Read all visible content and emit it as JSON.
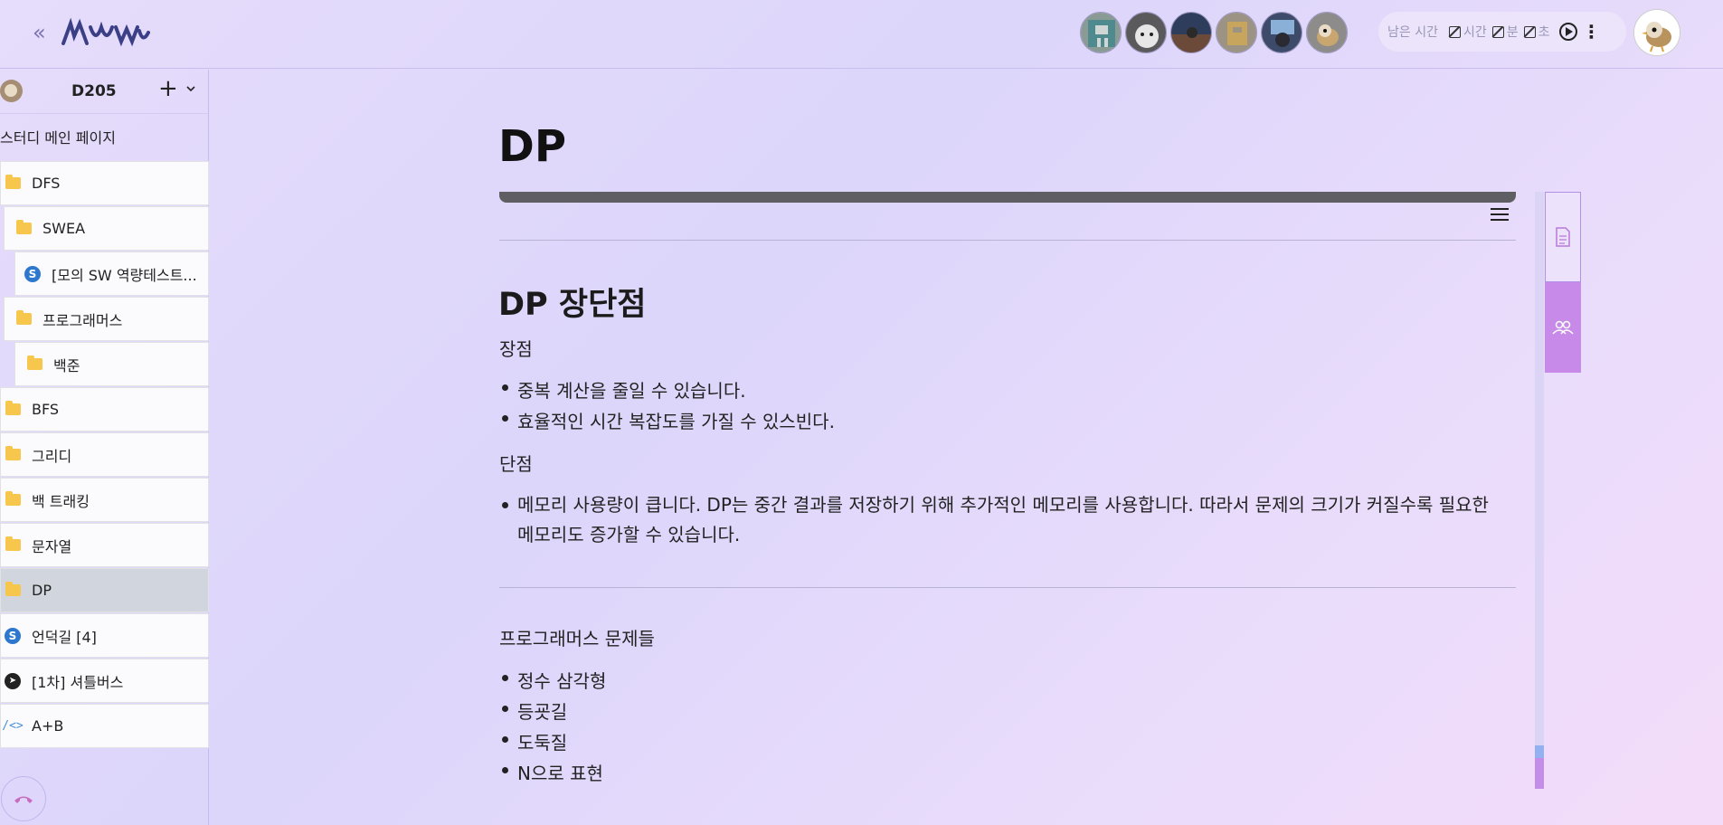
{
  "header": {
    "collapse_symbol": "«",
    "logo_text": "ɹʍʍ",
    "timer": {
      "label": "남은 시간",
      "hour": "시간",
      "minute": "분",
      "second": "초",
      "more": "⋮"
    }
  },
  "sidebar": {
    "workspace": "D205",
    "add": "+",
    "caret": "⌄",
    "main_page": "스터디 메인 페이지",
    "items": [
      {
        "label": "DFS",
        "icon": "folder-icon"
      },
      {
        "label": "SWEA",
        "icon": "folder-icon"
      },
      {
        "label": "[모의 SW 역량테스트...",
        "icon": "swea-logo-icon"
      },
      {
        "label": "프로그래머스",
        "icon": "folder-icon"
      },
      {
        "label": "백준",
        "icon": "folder-icon"
      },
      {
        "label": "BFS",
        "icon": "folder-icon"
      },
      {
        "label": "그리디",
        "icon": "folder-icon"
      },
      {
        "label": "백 트래킹",
        "icon": "folder-icon"
      },
      {
        "label": "문자열",
        "icon": "folder-icon"
      },
      {
        "label": "DP",
        "icon": "folder-icon"
      },
      {
        "label": "언덕길 [4]",
        "icon": "swea-logo-icon"
      },
      {
        "label": "[1차] 셔틀버스",
        "icon": "programmers-logo-icon"
      },
      {
        "label": "A+B",
        "icon": "code-icon"
      }
    ]
  },
  "doc": {
    "title": "DP",
    "heading": "DP 장단점",
    "pros_label": "장점",
    "pros": [
      "중복 계산을 줄일 수 있습니다.",
      "효율적인 시간 복잡도를 가질 수 있스빈다."
    ],
    "cons_label": "단점",
    "cons": [
      "메모리 사용량이 큽니다. DP는 중간 결과를 저장하기 위해 추가적인 메모리를 사용합니다. 따라서 문제의 크기가 커질수록 필요한 메모리도 증가할 수 있습니다."
    ],
    "problems_label": "프로그래머스 문제들",
    "problems": [
      "정수 삼각형",
      "등굣길",
      "도둑질",
      "N으로 표현"
    ]
  }
}
